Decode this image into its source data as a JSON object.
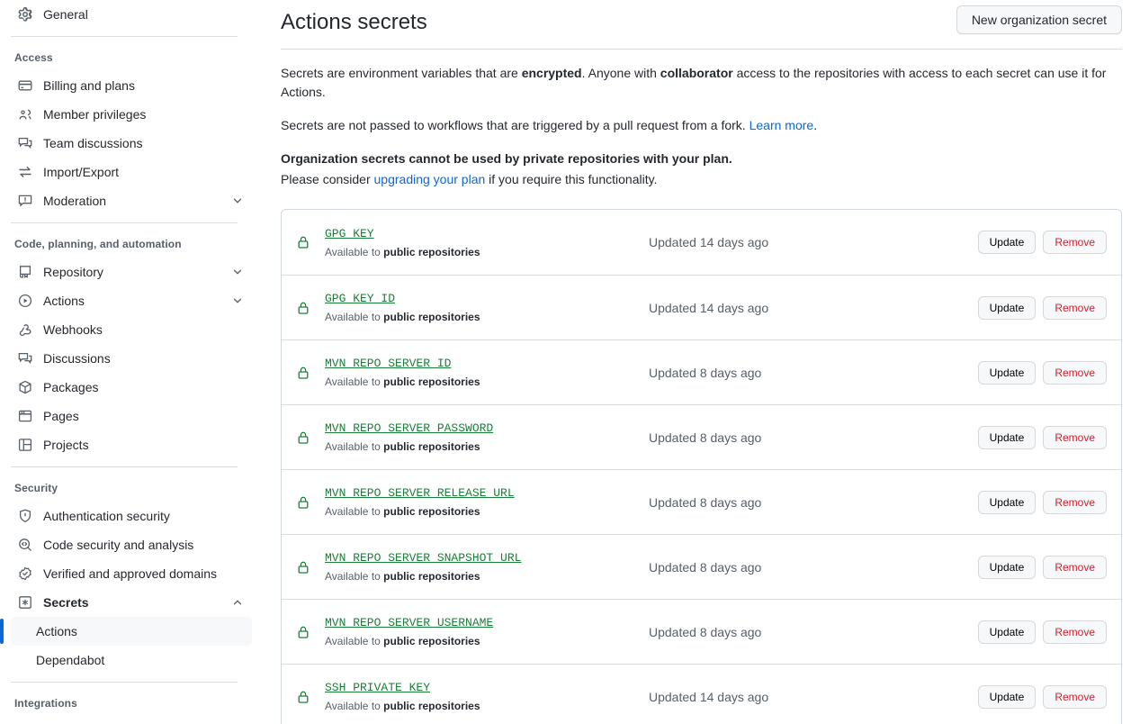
{
  "sidebar": {
    "top_items": [
      {
        "label": "General",
        "icon": "gear-icon",
        "name": "general"
      }
    ],
    "groups": [
      {
        "title": "Access",
        "items": [
          {
            "label": "Billing and plans",
            "icon": "credit-card-icon",
            "name": "billing-and-plans",
            "chevron": false
          },
          {
            "label": "Member privileges",
            "icon": "people-icon",
            "name": "member-privileges",
            "chevron": false
          },
          {
            "label": "Team discussions",
            "icon": "comment-discussion-icon",
            "name": "team-discussions",
            "chevron": false
          },
          {
            "label": "Import/Export",
            "icon": "arrow-switch-icon",
            "name": "import-export",
            "chevron": false
          },
          {
            "label": "Moderation",
            "icon": "report-icon",
            "name": "moderation",
            "chevron": true
          }
        ]
      },
      {
        "title": "Code, planning, and automation",
        "items": [
          {
            "label": "Repository",
            "icon": "repo-icon",
            "name": "repository",
            "chevron": true
          },
          {
            "label": "Actions",
            "icon": "play-icon",
            "name": "actions",
            "chevron": true
          },
          {
            "label": "Webhooks",
            "icon": "webhook-icon",
            "name": "webhooks",
            "chevron": false
          },
          {
            "label": "Discussions",
            "icon": "comment-discussion-icon",
            "name": "discussions",
            "chevron": false
          },
          {
            "label": "Packages",
            "icon": "package-icon",
            "name": "packages",
            "chevron": false
          },
          {
            "label": "Pages",
            "icon": "browser-icon",
            "name": "pages",
            "chevron": false
          },
          {
            "label": "Projects",
            "icon": "project-icon",
            "name": "projects",
            "chevron": false
          }
        ]
      },
      {
        "title": "Security",
        "items": [
          {
            "label": "Authentication security",
            "icon": "shield-lock-icon",
            "name": "authentication-security",
            "chevron": false
          },
          {
            "label": "Code security and analysis",
            "icon": "codescan-icon",
            "name": "code-security-and-analysis",
            "chevron": false
          },
          {
            "label": "Verified and approved domains",
            "icon": "verified-icon",
            "name": "verified-and-approved-domains",
            "chevron": false
          },
          {
            "label": "Secrets",
            "icon": "key-asterisk-icon",
            "name": "secrets",
            "chevron": true,
            "expanded": true,
            "bold": true
          }
        ],
        "subitems": [
          {
            "label": "Actions",
            "name": "secrets-actions",
            "selected": true
          },
          {
            "label": "Dependabot",
            "name": "secrets-dependabot",
            "selected": false
          }
        ]
      },
      {
        "title": "Integrations",
        "items": []
      }
    ]
  },
  "header": {
    "title": "Actions secrets",
    "new_secret_button": "New organization secret"
  },
  "intro": {
    "p1_a": "Secrets are environment variables that are ",
    "p1_b": "encrypted",
    "p1_c": ". Anyone with ",
    "p1_d": "collaborator",
    "p1_e": " access to the repositories with access to each secret can use it for Actions.",
    "p2_a": "Secrets are not passed to workflows that are triggered by a pull request from a fork. ",
    "p2_link": "Learn more",
    "p2_b": ".",
    "plan_strong": "Organization secrets cannot be used by private repositories with your plan.",
    "plan_sub_a": "Please consider ",
    "plan_sub_link": "upgrading your plan",
    "plan_sub_b": " if you require this functionality."
  },
  "secrets_list": {
    "available_prefix": "Available to ",
    "available_scope": "public repositories",
    "update_label": "Update",
    "remove_label": "Remove",
    "rows": [
      {
        "name": "GPG_KEY",
        "updated": "Updated 14 days ago"
      },
      {
        "name": "GPG_KEY_ID",
        "updated": "Updated 14 days ago"
      },
      {
        "name": "MVN_REPO_SERVER_ID",
        "updated": "Updated 8 days ago"
      },
      {
        "name": "MVN_REPO_SERVER_PASSWORD",
        "updated": "Updated 8 days ago"
      },
      {
        "name": "MVN_REPO_SERVER_RELEASE_URL",
        "updated": "Updated 8 days ago"
      },
      {
        "name": "MVN_REPO_SERVER_SNAPSHOT_URL",
        "updated": "Updated 8 days ago"
      },
      {
        "name": "MVN_REPO_SERVER_USERNAME",
        "updated": "Updated 8 days ago"
      },
      {
        "name": "SSH_PRIVATE_KEY",
        "updated": "Updated 14 days ago"
      }
    ]
  },
  "colors": {
    "link": "#0969da",
    "secret_name": "#1a7f37",
    "danger": "#cf222e",
    "muted": "#57606a",
    "border": "#d8dee4",
    "selected_bg": "#f6f8fa",
    "accent_bar": "#0969da"
  }
}
